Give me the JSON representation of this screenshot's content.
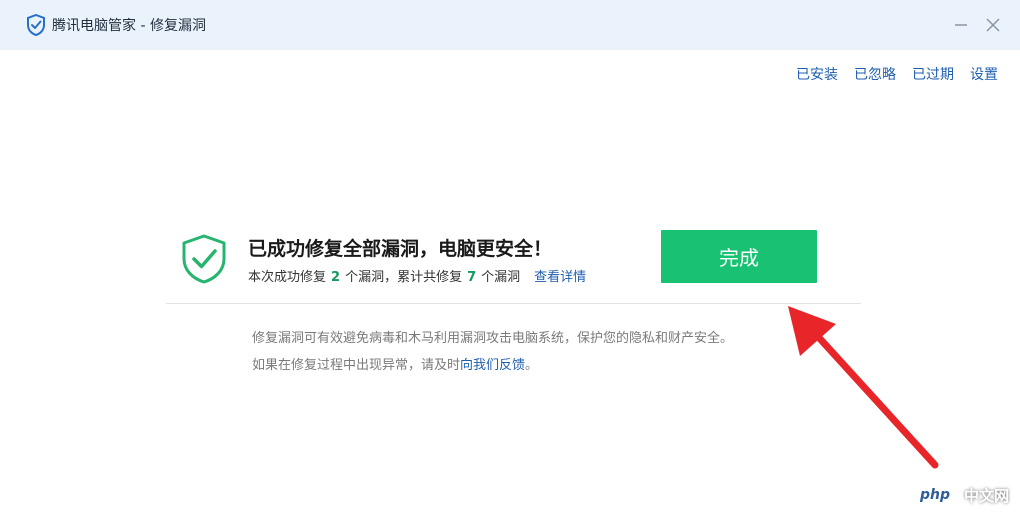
{
  "window": {
    "title": "腾讯电脑管家 - 修复漏洞",
    "logo_icon": "shield-logo-icon"
  },
  "toplinks": {
    "installed": "已安装",
    "ignored": "已忽略",
    "expired": "已过期",
    "settings": "设置"
  },
  "result": {
    "headline": "已成功修复全部漏洞，电脑更安全！",
    "sub_prefix": "本次成功修复",
    "fixed_count": "2",
    "sub_mid": "个漏洞，累计共修复",
    "total_count": "7",
    "sub_suffix": "个漏洞",
    "details_link": "查看详情",
    "done_button": "完成"
  },
  "info": {
    "line1": "修复漏洞可有效避免病毒和木马利用漏洞攻击电脑系统，保护您的隐私和财产安全。",
    "line2_prefix": "如果在修复过程中出现异常，请及时",
    "feedback_link": "向我们反馈",
    "line2_suffix": "。"
  },
  "watermark": {
    "badge": "php",
    "text": "中文网"
  },
  "colors": {
    "accent_green": "#18c272",
    "link_blue": "#1f5fb0",
    "titlebar_bg": "#eaf2fb",
    "arrow_red": "#e8262a"
  }
}
